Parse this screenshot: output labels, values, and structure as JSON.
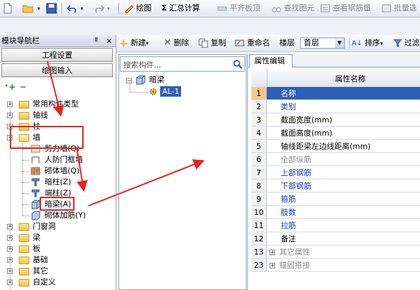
{
  "toolbar": {
    "draw": "绘图",
    "sum_calc": "汇总计算",
    "flat_slab_top": "平齐板顶",
    "find_element": "查找图元",
    "view_rebar_qty": "查看钢筋量",
    "batch_select": "批量选"
  },
  "nav_panel": {
    "title": "模块导航栏",
    "pin": "Ⅱ",
    "close": "×",
    "project_settings": "工程设置",
    "drawing_input": "绘图输入",
    "tree": [
      {
        "label": "常用构件类型",
        "expanded": false
      },
      {
        "label": "轴线",
        "expanded": false
      },
      {
        "label": "柱",
        "expanded": false
      },
      {
        "label": "墙",
        "expanded": true,
        "children": [
          "剪力墙(Q)",
          "人防门框墙",
          "砌体墙(Q)",
          "暗柱(Z)",
          "端柱(Z)",
          "暗梁(A)",
          "砌体加筋(Y)"
        ]
      },
      {
        "label": "门窗洞",
        "expanded": false
      },
      {
        "label": "梁",
        "expanded": false
      },
      {
        "label": "板",
        "expanded": false
      },
      {
        "label": "基础",
        "expanded": false
      },
      {
        "label": "其它",
        "expanded": false
      },
      {
        "label": "自定义",
        "expanded": false
      }
    ]
  },
  "toolbar2": {
    "new": "新建",
    "delete": "删除",
    "copy": "复制",
    "rename": "重命名",
    "floor_label": "楼层",
    "floor_value": "首层",
    "sort": "排序",
    "filter": "过滤"
  },
  "component_list": {
    "search_placeholder": "搜索构件...",
    "group": "暗梁",
    "items": [
      "AL-1"
    ]
  },
  "property_editor": {
    "tab": "属性编辑",
    "header": "属性名称",
    "rows": [
      {
        "num": "1",
        "name": "名称",
        "style": "blue",
        "selected": true
      },
      {
        "num": "2",
        "name": "类别",
        "style": "blue"
      },
      {
        "num": "3",
        "name": "截面宽度(mm)",
        "style": "black"
      },
      {
        "num": "4",
        "name": "截面高度(mm)",
        "style": "black"
      },
      {
        "num": "5",
        "name": "轴线距梁左边线距离(mm)",
        "style": "black"
      },
      {
        "num": "6",
        "name": "全部纵筋",
        "style": "gray"
      },
      {
        "num": "7",
        "name": "上部钢筋",
        "style": "blue"
      },
      {
        "num": "8",
        "name": "下部钢筋",
        "style": "blue"
      },
      {
        "num": "9",
        "name": "箍筋",
        "style": "blue"
      },
      {
        "num": "10",
        "name": "肢数",
        "style": "blue"
      },
      {
        "num": "11",
        "name": "拉筋",
        "style": "blue"
      },
      {
        "num": "12",
        "name": "备注",
        "style": "black"
      },
      {
        "num": "13",
        "name": "其它属性",
        "style": "gray",
        "expandable": true
      },
      {
        "num": "23",
        "name": "锚固搭接",
        "style": "gray",
        "expandable": true
      }
    ]
  },
  "colors": {
    "annotation_red": "#e8221c",
    "selection_blue": "#2e5fb7",
    "link_blue": "#1c36c4"
  }
}
